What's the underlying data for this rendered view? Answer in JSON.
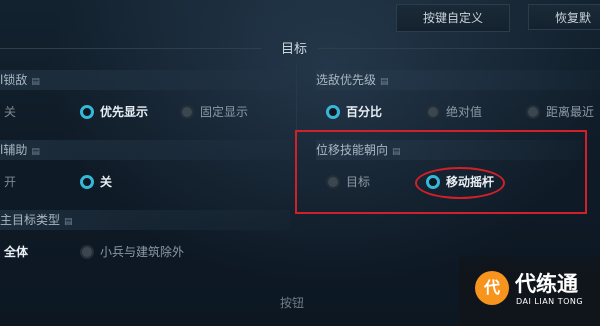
{
  "topbar": {
    "custom_keys_label": "按键自定义",
    "restore_label": "恢复默"
  },
  "section_title": "目标",
  "left_col": {
    "g1": {
      "header": "l锁敌",
      "opt_off": "关",
      "opt_priority": "优先显示",
      "opt_fixed": "固定显示"
    },
    "g2": {
      "header": "l辅助",
      "opt_on": "开",
      "opt_off": "关"
    },
    "g3": {
      "header": "主目标类型",
      "opt_all": "全体",
      "opt_exclude": "小兵与建筑除外"
    }
  },
  "right_col": {
    "enemy_priority": {
      "header": "选敌优先级",
      "opt_percent": "百分比",
      "opt_absolute": "绝对值",
      "opt_distance": "距离最近"
    },
    "displacement": {
      "header": "位移技能朝向",
      "opt_target": "目标",
      "opt_joystick": "移动摇杆"
    }
  },
  "bottom_title": "按钮",
  "watermark": {
    "mark": "代",
    "name": "代练通",
    "sub": "DAI LIAN TONG"
  },
  "colors": {
    "accent": "#36b7d8",
    "highlight": "#d0202a",
    "logo": "#f7941d"
  }
}
